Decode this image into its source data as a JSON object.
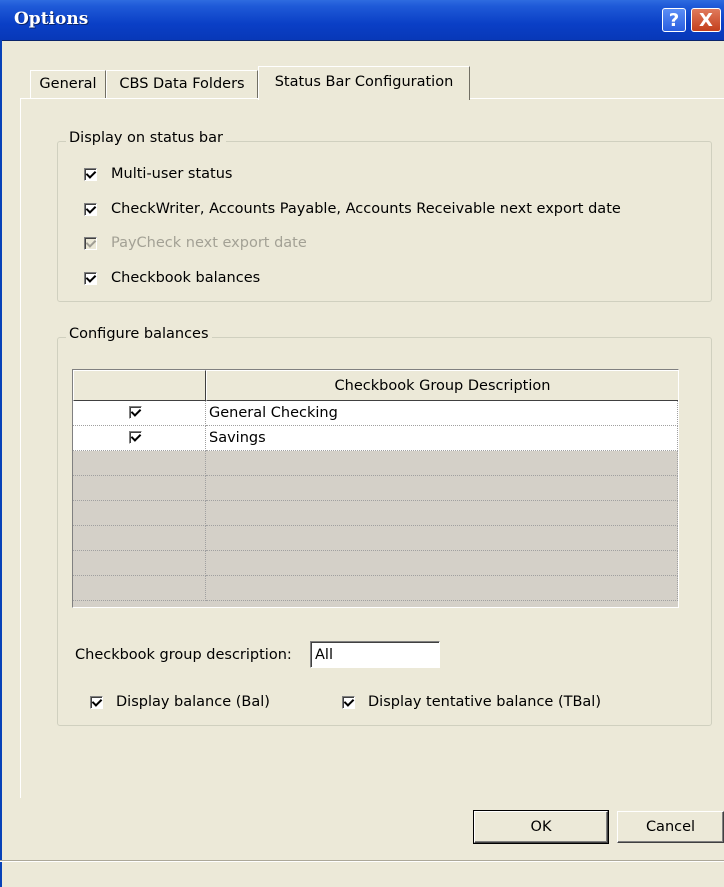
{
  "window": {
    "title": "Options",
    "help_label": "?",
    "close_label": "X"
  },
  "tabs": [
    {
      "label": "General"
    },
    {
      "label": "CBS Data Folders"
    },
    {
      "label": "Status Bar Configuration",
      "active": true
    }
  ],
  "display_group": {
    "title": "Display on status bar",
    "options": [
      {
        "label": "Multi-user status",
        "checked": true,
        "enabled": true
      },
      {
        "label": "CheckWriter, Accounts Payable, Accounts Receivable next export date",
        "checked": true,
        "enabled": true
      },
      {
        "label": "PayCheck next export date",
        "checked": true,
        "enabled": false
      },
      {
        "label": "Checkbook balances",
        "checked": true,
        "enabled": true
      }
    ]
  },
  "balances_group": {
    "title": "Configure balances",
    "grid": {
      "columns": [
        "",
        "Checkbook Group Description"
      ],
      "rows": [
        {
          "checked": true,
          "description": "General Checking"
        },
        {
          "checked": true,
          "description": "Savings"
        }
      ]
    },
    "description_label": "Checkbook group description:",
    "description_value": "All",
    "display_balance_label": "Display balance (Bal)",
    "display_balance_checked": true,
    "display_tentative_label": "Display tentative balance (TBal)",
    "display_tentative_checked": true
  },
  "buttons": {
    "ok": "OK",
    "cancel": "Cancel"
  }
}
